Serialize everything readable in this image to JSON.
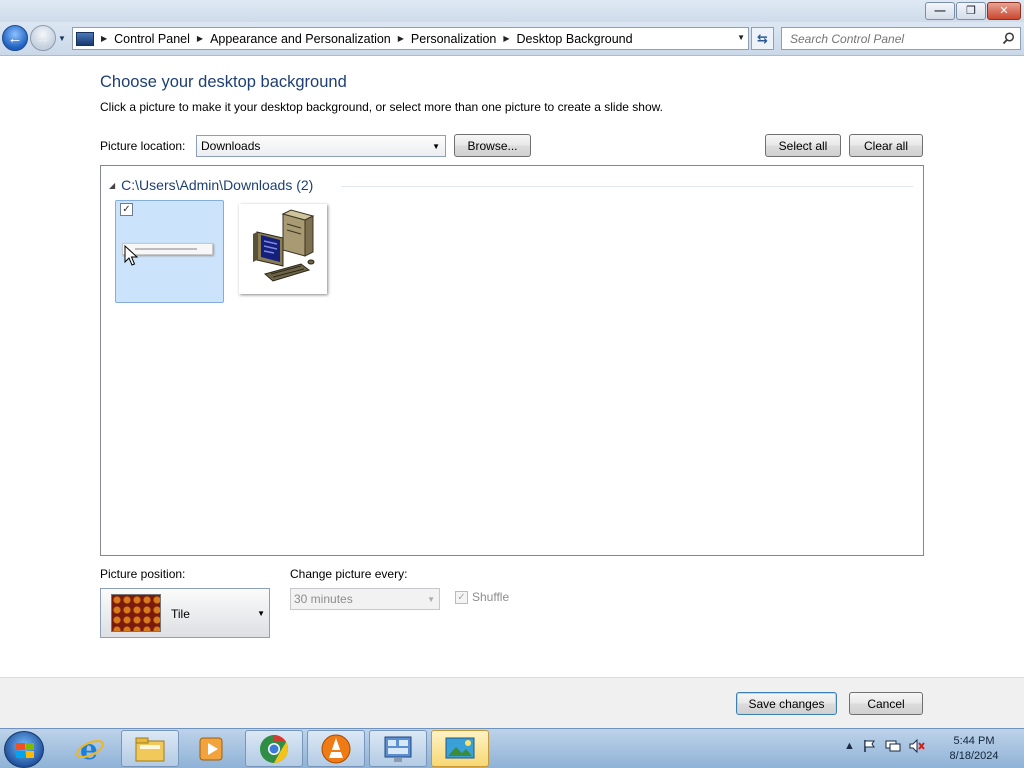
{
  "window": {
    "minimize_glyph": "—",
    "maximize_glyph": "❐",
    "close_glyph": "✕"
  },
  "nav": {
    "breadcrumbs": [
      "Control Panel",
      "Appearance and Personalization",
      "Personalization",
      "Desktop Background"
    ],
    "search_placeholder": "Search Control Panel"
  },
  "main": {
    "title": "Choose your desktop background",
    "description": "Click a picture to make it your desktop background, or select more than one picture to create a slide show.",
    "picture_location_label": "Picture location:",
    "picture_location_value": "Downloads",
    "browse_label": "Browse...",
    "select_all_label": "Select all",
    "clear_all_label": "Clear all",
    "group_header": "C:\\Users\\Admin\\Downloads (2)",
    "thumbnails": [
      {
        "name": "thumbnail-1",
        "selected": true
      },
      {
        "name": "thumbnail-2",
        "selected": false
      }
    ],
    "picture_position_label": "Picture position:",
    "picture_position_value": "Tile",
    "change_picture_label": "Change picture every:",
    "change_picture_value": "30 minutes",
    "shuffle_label": "Shuffle",
    "shuffle_checked": true
  },
  "footer": {
    "save_label": "Save changes",
    "cancel_label": "Cancel"
  },
  "taskbar": {
    "apps": [
      "internet-explorer",
      "file-explorer",
      "windows-media-player",
      "chrome",
      "vlc",
      "control-panel",
      "personalization"
    ],
    "clock_time": "5:44 PM",
    "clock_date": "8/18/2024"
  },
  "colors": {
    "title_blue": "#1e3f73",
    "selection_bg": "#cce4fb",
    "taskbar": "#9ebde0"
  }
}
